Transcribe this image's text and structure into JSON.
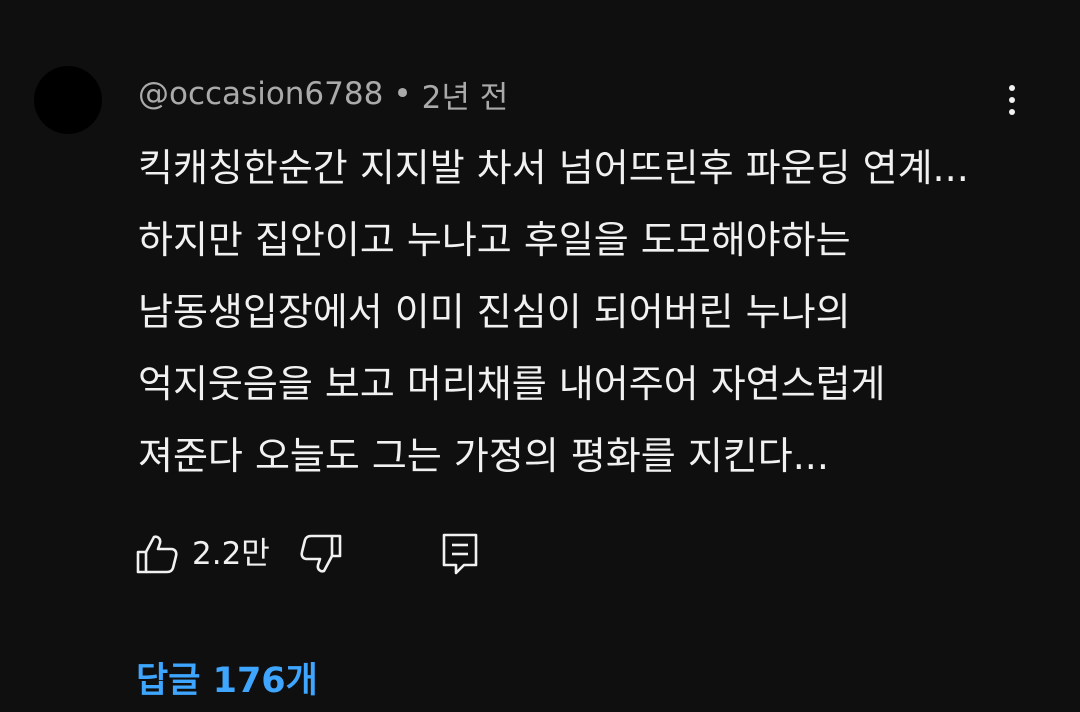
{
  "comment": {
    "author": "@occasion6788",
    "separator": "•",
    "time": "2년 전",
    "body_lines": [
      "킥캐칭한순간 지지발 차서 넘어뜨린후 파운딩 연계...",
      "하지만 집안이고 누나고 후일을 도모해야하는",
      "남동생입장에서 이미 진심이 되어버린 누나의",
      "억지웃음을 보고 머리채를 내어주어 자연스럽게",
      "져준다 오늘도 그는 가정의 평화를 지킨다..."
    ],
    "like_count": "2.2만",
    "replies_label": "답글 176개"
  },
  "icons": {
    "avatar": "avatar",
    "more": "more-vertical-icon",
    "like": "thumbs-up-icon",
    "dislike": "thumbs-down-icon",
    "reply": "comment-reply-icon"
  },
  "colors": {
    "background": "#0f0f0f",
    "text_primary": "#f1f1f1",
    "text_secondary": "#aaaaaa",
    "link_blue": "#3ea6ff",
    "avatar": "#000000"
  }
}
